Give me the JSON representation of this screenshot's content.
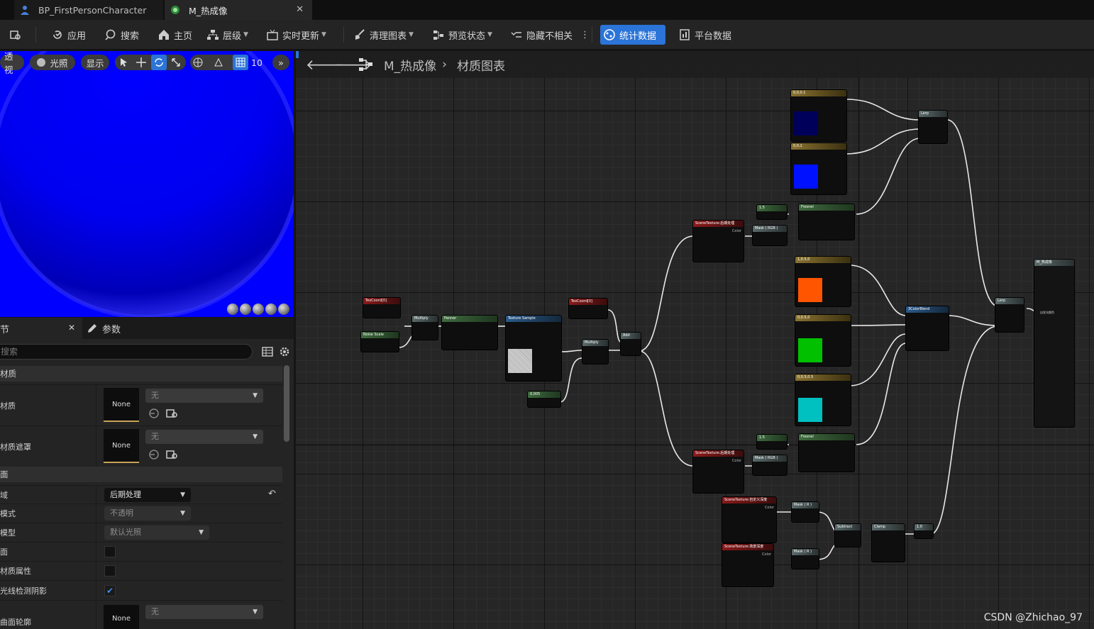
{
  "tabs": [
    {
      "label": "BP_FirstPersonCharacter"
    },
    {
      "label": "M_热成像"
    }
  ],
  "toolbar": {
    "apply": "应用",
    "search": "搜索",
    "home": "主页",
    "hierarchy": "层级",
    "live_update": "实时更新",
    "clean_graph": "清理图表",
    "preview_state": "预览状态",
    "hide_unrelated": "隐藏不相关",
    "stats": "统计数据",
    "platform_stats": "平台数据"
  },
  "viewport": {
    "perspective": "透视",
    "lit": "光照",
    "show": "显示",
    "grid_size": "10"
  },
  "details": {
    "tab_details": "节",
    "tab_params": "参数",
    "search_placeholder": "搜索",
    "section_material": "材质",
    "row_material": "材质",
    "row_material_mask": "材质遮罩",
    "none": "None",
    "none_value": "无",
    "section_surface": "面",
    "row_domain": "域",
    "domain_value": "后期处理",
    "row_blend": "模式",
    "blend_value": "不透明",
    "row_shading": "模型",
    "shading_value": "默认光照",
    "row_twosided": "面",
    "row_material_attr": "材质属性",
    "row_raytrace": "光线检测阴影",
    "row_contour": "曲面轮廓"
  },
  "graph": {
    "title": "M_热成像",
    "breadcrumb": "材质图表",
    "nodes": {
      "c001": "0,0,0.1",
      "c01": "0,0,1",
      "lerp": "Lerp",
      "fresnel": "Fresnel",
      "st": "SceneTexture:后期处理",
      "st_sub": "输入后期",
      "st_uvs": "UVs",
      "st_color": "Color",
      "st_size": "Size",
      "st_invsize": "InvSize",
      "c15": "1.5",
      "mask_rgb": "Mask ( RGB )",
      "c105": "1,0.5,0",
      "c010": "0,0.5,0",
      "c0505": "0,0.5,0.5",
      "cblend": "3ColorBlend",
      "texcoord": "TexCoord[0]",
      "noise": "Noise Scale",
      "multiply": "Multiply",
      "panner": "Panner",
      "texsample": "Texture Sample",
      "add": "Add",
      "c0005": "0.005",
      "st_depth": "SceneTexture:自定义深度",
      "st_scene": "SceneTexture:场景深度",
      "mask_r": "Mask ( R )",
      "subtract": "Subtract",
      "clamp": "Clamp",
      "c1": "1.0",
      "out": "M_热成像",
      "emissive": "自发光颜色"
    }
  },
  "watermark": "CSDN @Zhichao_97"
}
